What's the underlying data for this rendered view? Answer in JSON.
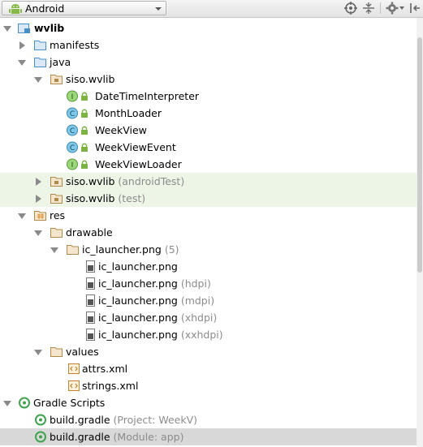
{
  "toolbar": {
    "view_selector": "Android",
    "icons": [
      "target-icon",
      "collapse-all-icon",
      "gear-icon",
      "hide-icon"
    ]
  },
  "tree": [
    {
      "name": "wvlib",
      "bold": true
    },
    {
      "name": "manifests"
    },
    {
      "name": "java"
    },
    {
      "name": "siso.wvlib"
    },
    {
      "name": "DateTimeInterpreter",
      "badge": "I"
    },
    {
      "name": "MonthLoader",
      "badge": "C"
    },
    {
      "name": "WeekView",
      "badge": "C"
    },
    {
      "name": "WeekViewEvent",
      "badge": "C"
    },
    {
      "name": "WeekViewLoader",
      "badge": "I"
    },
    {
      "name": "siso.wvlib",
      "suffix": "(androidTest)"
    },
    {
      "name": "siso.wvlib",
      "suffix": "(test)"
    },
    {
      "name": "res"
    },
    {
      "name": "drawable"
    },
    {
      "name": "ic_launcher.png",
      "suffix": "(5)"
    },
    {
      "name": "ic_launcher.png"
    },
    {
      "name": "ic_launcher.png",
      "suffix": "(hdpi)"
    },
    {
      "name": "ic_launcher.png",
      "suffix": "(mdpi)"
    },
    {
      "name": "ic_launcher.png",
      "suffix": "(xhdpi)"
    },
    {
      "name": "ic_launcher.png",
      "suffix": "(xxhdpi)"
    },
    {
      "name": "values"
    },
    {
      "name": "attrs.xml"
    },
    {
      "name": "strings.xml"
    },
    {
      "name": "Gradle Scripts"
    },
    {
      "name": "build.gradle",
      "suffix": "(Project: WeekV)"
    },
    {
      "name": "build.gradle",
      "suffix": "(Module: app)"
    }
  ],
  "colors": {
    "class_badge": "#7fc8e8",
    "interface_badge": "#9bd87a",
    "folder": "#4a90c8",
    "package_folder": "#c8a060",
    "selected_row": "#d8d8d8",
    "test_row": "#edf5e6"
  }
}
